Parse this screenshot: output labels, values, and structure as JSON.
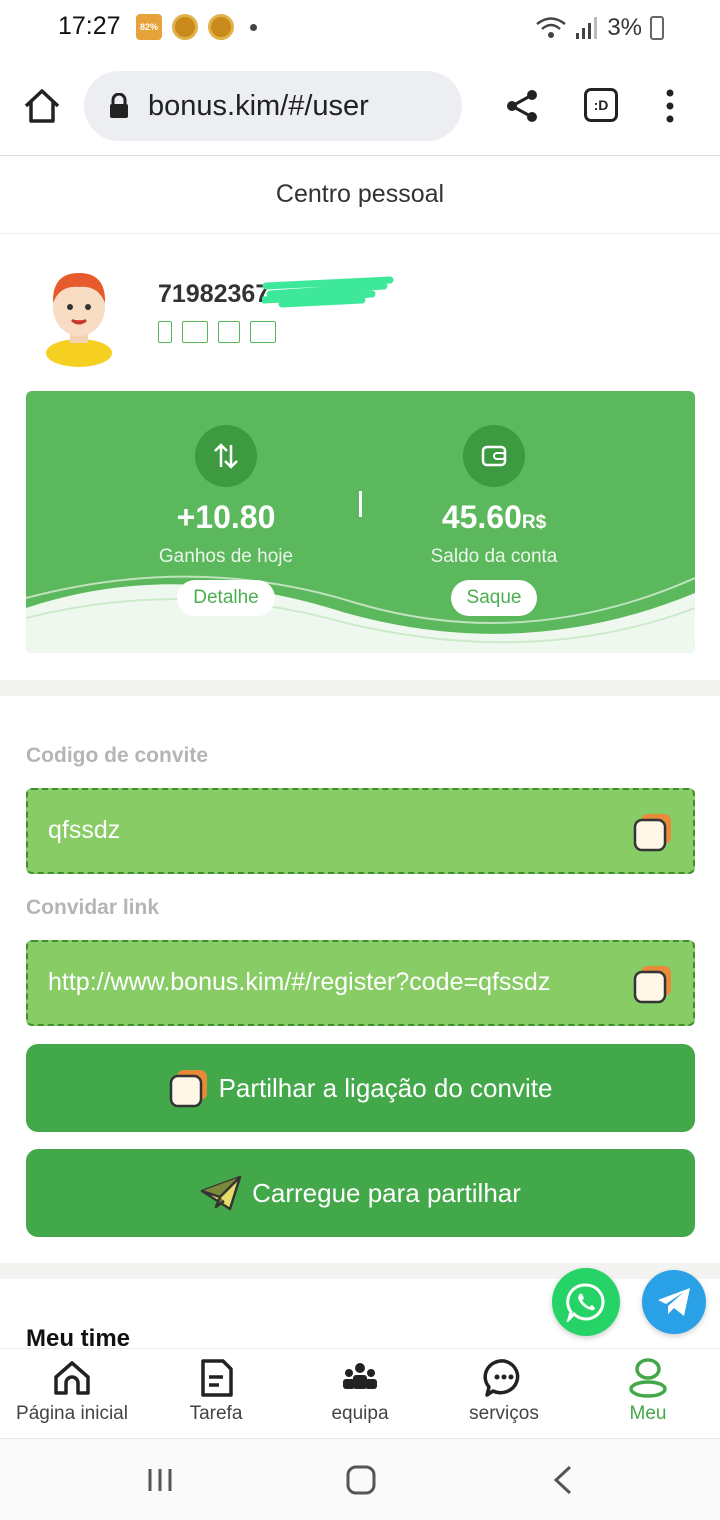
{
  "status_bar": {
    "time": "17:27",
    "badge": "82%",
    "battery": "3%"
  },
  "browser": {
    "url": "bonus.kim/#/user",
    "tab_label": ":D"
  },
  "page": {
    "title": "Centro pessoal"
  },
  "user": {
    "id": "71982367"
  },
  "stats": {
    "today_value": "+10.80",
    "today_label": "Ganhos de hoje",
    "today_button": "Detalhe",
    "balance_value": "45.60",
    "balance_unit": "R$",
    "balance_label": "Saldo da conta",
    "balance_button": "Saque"
  },
  "invite": {
    "code_label": "Codigo de convite",
    "code_value": "qfssdz",
    "link_label": "Convidar link",
    "link_value": "http://www.bonus.kim/#/register?code=qfssdz",
    "share_button": "Partilhar a ligação do convite",
    "upload_button": "Carregue para partilhar"
  },
  "team": {
    "title": "Meu time"
  },
  "bottom_nav": [
    {
      "label": "Página inicial"
    },
    {
      "label": "Tarefa"
    },
    {
      "label": "equipa"
    },
    {
      "label": "serviços"
    },
    {
      "label": "Meu"
    }
  ],
  "colors": {
    "primary_green": "#43a84a",
    "card_green": "#5cb85c",
    "field_green": "#88cc66"
  }
}
